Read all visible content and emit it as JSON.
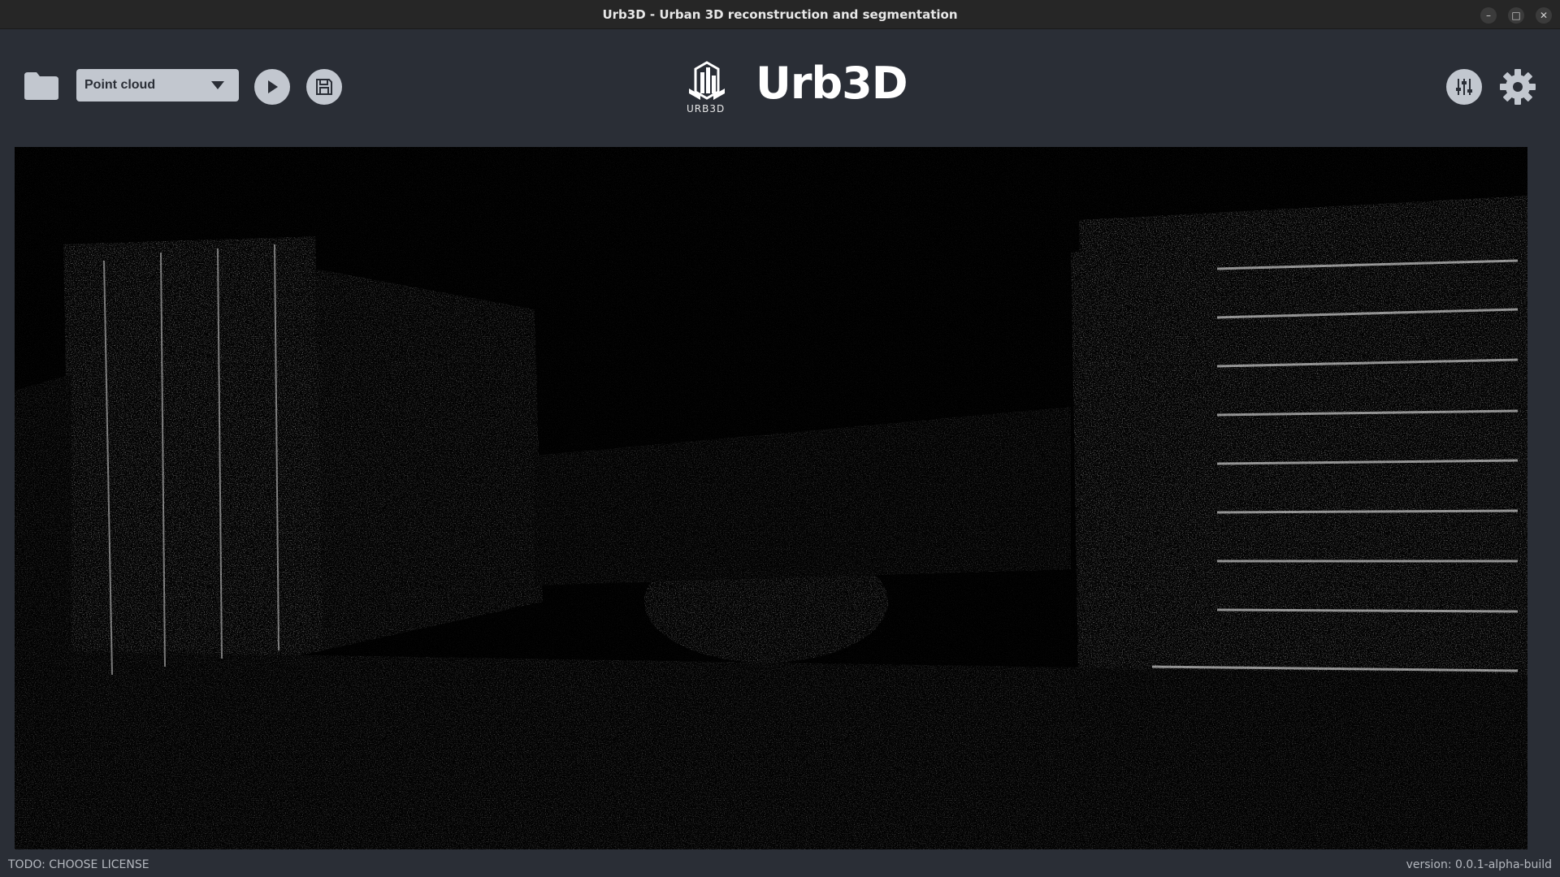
{
  "window": {
    "title": "Urb3D - Urban 3D reconstruction and segmentation",
    "controls": {
      "minimize": "–",
      "maximize": "□",
      "close": "✕"
    }
  },
  "toolbar": {
    "open_icon": "folder-icon",
    "mode_select": {
      "value": "Point cloud",
      "icon": "chevron-down-icon"
    },
    "run_icon": "play-icon",
    "save_icon": "save-icon",
    "filters_icon": "sliders-icon",
    "settings_icon": "gear-icon"
  },
  "brand": {
    "logo_text": "URB3D",
    "name": "Urb3D"
  },
  "viewer": {
    "content": "point-cloud-view",
    "background": "#000000",
    "point_color": "#ffffff"
  },
  "status": {
    "license": "TODO: CHOOSE LICENSE",
    "version": "version: 0.0.1-alpha-build"
  },
  "colors": {
    "background": "#2a2e36",
    "titlebar": "#262626",
    "button": "#c2c7cf",
    "icon_dark": "#2a2e36"
  }
}
